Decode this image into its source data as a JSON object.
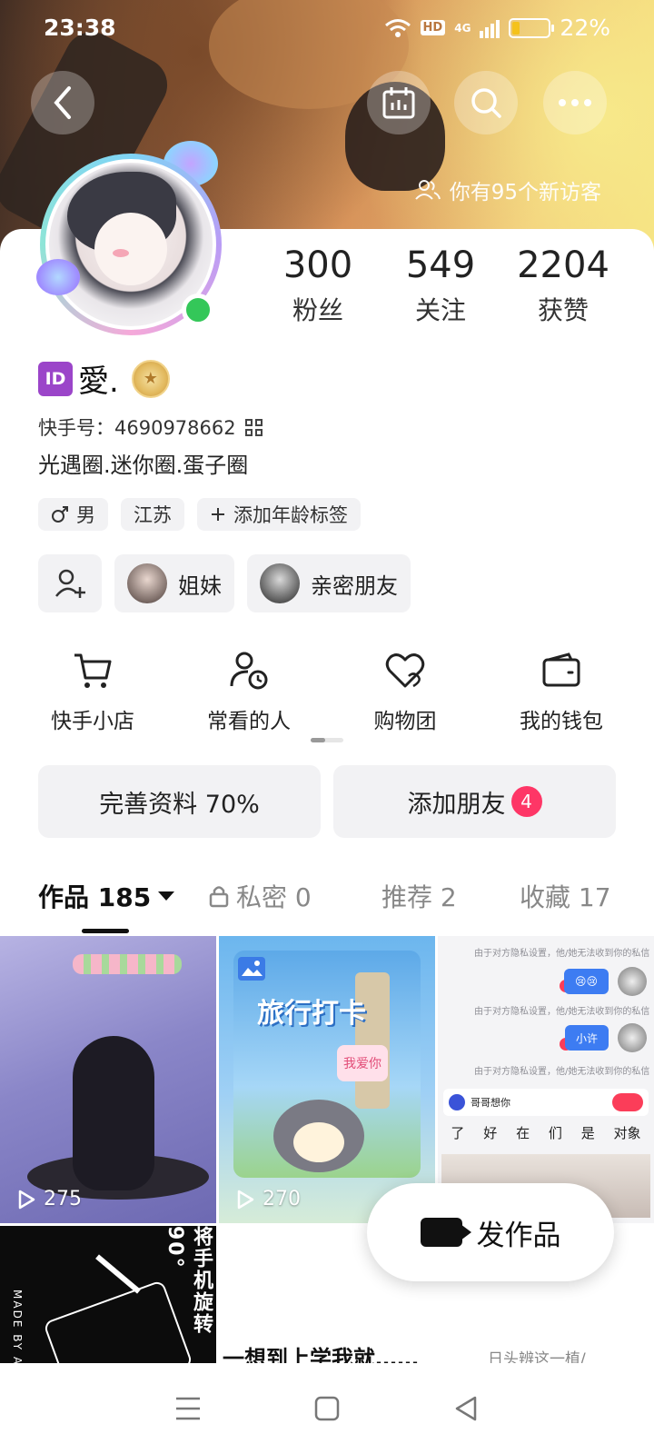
{
  "status_bar": {
    "time": "23:38",
    "network_badge": "HD",
    "cell_type": "4G",
    "battery_percent": "22%",
    "battery_level": 0.22
  },
  "header": {
    "visitors_text": "你有95个新访客"
  },
  "profile": {
    "id_badge": "ID",
    "name": "愛.",
    "kuaishou_id_label": "快手号：",
    "kuaishou_id": "4690978662",
    "bio": "光遇圈.迷你圈.蛋子圈",
    "stats": [
      {
        "value": "300",
        "label": "粉丝"
      },
      {
        "value": "549",
        "label": "关注"
      },
      {
        "value": "2204",
        "label": "获赞"
      }
    ],
    "tags": [
      {
        "icon": "male-icon",
        "label": "男"
      },
      {
        "label": "江苏"
      },
      {
        "icon": "plus-icon",
        "label": "添加年龄标签"
      }
    ],
    "relations": [
      {
        "label": "姐妹"
      },
      {
        "label": "亲密朋友"
      }
    ]
  },
  "services": [
    {
      "icon": "cart-icon",
      "label": "快手小店"
    },
    {
      "icon": "user-clock-icon",
      "label": "常看的人"
    },
    {
      "icon": "heart-icon",
      "label": "购物团"
    },
    {
      "icon": "wallet-icon",
      "label": "我的钱包"
    }
  ],
  "actions": {
    "complete_profile": "完善资料 70%",
    "add_friends": "添加朋友",
    "add_friends_badge": "4"
  },
  "tabs": [
    {
      "label": "作品 185",
      "active": true
    },
    {
      "label": "私密 0",
      "icon": "lock-icon"
    },
    {
      "label": "推荐 2"
    },
    {
      "label": "收藏 17"
    }
  ],
  "grid": {
    "items": [
      {
        "play_count": "275"
      },
      {
        "play_count": "270",
        "title_text": "旅行打卡",
        "sticker_text": "我爱你"
      },
      {
        "chat_notices": [
          "由于对方隐私设置，他/她无法收到你的私信",
          "由于对方隐私设置，他/她无法收到你的私信",
          "由于对方隐私设置，他/她无法收到你的私信"
        ],
        "bubble_1": "😢😢",
        "bubble_2": "小许",
        "input_text": "哥哥想你",
        "suggestions": [
          "了",
          "好",
          "在",
          "们",
          "是",
          "对象"
        ]
      },
      {
        "vertical_text": "将手机旋转90°",
        "side_text": "MADE BY A"
      },
      {
        "caption": "一想到上学我就……",
        "caption_right": "日头辨这一植/"
      }
    ]
  },
  "fab": {
    "label": "发作品"
  }
}
